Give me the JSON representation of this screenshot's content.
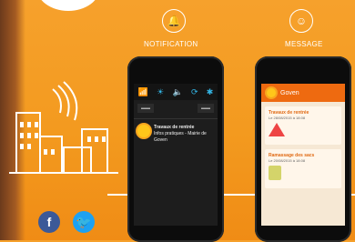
{
  "features": {
    "notification_label": "NOTIFICATION",
    "message_label": "MESSAGE"
  },
  "phone1": {
    "tabs": [
      "",
      ""
    ],
    "notification": {
      "title": "Travaux de rentrée",
      "text": "Infos pratiques - Mairie de Goven"
    }
  },
  "phone2": {
    "app_title": "Goven",
    "cards": [
      {
        "title": "Travaux de rentrée",
        "sub": "Le 28/08/2015 à 18:08"
      },
      {
        "title": "Ramassage des sacs",
        "sub": "Le 20/08/2015 à 18:08"
      }
    ]
  },
  "social": {
    "facebook": "f",
    "twitter": "t"
  },
  "colors": {
    "bg": "#f39a1f",
    "accent": "#ee6a10",
    "facebook": "#3b5998",
    "twitter": "#1da1f2"
  }
}
